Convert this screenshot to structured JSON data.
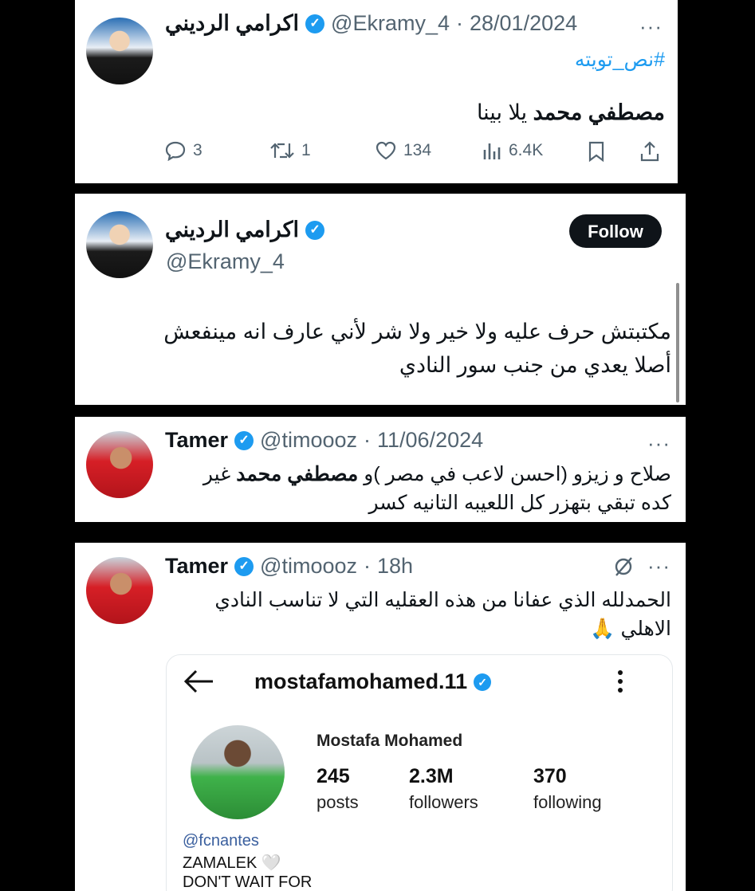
{
  "tweet1": {
    "name": "اكرامي الرديني",
    "handle": "@Ekramy_4",
    "date": "28/01/2024",
    "more_icon": "more-dots-icon",
    "hashtag": "#نص_تويته",
    "body_bold": "مصطفي محمد",
    "body_rest": "يلا بينا",
    "actions": {
      "replies": "3",
      "retweets": "1",
      "likes": "134",
      "views": "6.4K"
    }
  },
  "tweet2": {
    "name": "اكرامي الرديني",
    "handle": "@Ekramy_4",
    "follow_label": "Follow",
    "line1": "مكتبتش حرف عليه ولا خير ولا شر لأني عارف انه مينفعش",
    "line2": "أصلا يعدي من جنب سور النادي"
  },
  "tweet3": {
    "name": "Tamer",
    "handle": "@timoooz",
    "date": "11/06/2024",
    "line1_a": "صلاح و زيزو (احسن لاعب في مصر )و",
    "line1_bold": "مصطفي محمد",
    "line1_b": "غير",
    "line2": "كده تبقي بتهزر كل اللعيبه التانيه كسر"
  },
  "tweet4": {
    "name": "Tamer",
    "handle": "@timoooz",
    "time": "18h",
    "line1": "الحمدلله الذي عفانا من هذه العقليه التي لا تناسب النادي",
    "line2": "الاهلي 🙏",
    "instagram": {
      "username": "mostafamohamed.11",
      "display_name": "Mostafa Mohamed",
      "posts_value": "245",
      "posts_label": "posts",
      "followers_value": "2.3M",
      "followers_label": "followers",
      "following_value": "370",
      "following_label": "following",
      "mention": "@fcnantes",
      "bio1": "ZAMALEK 🤍",
      "bio2": "DON'T WAIT FOR"
    }
  },
  "colors": {
    "link": "#1d9bf0",
    "verified": "#1d9bf0",
    "secondary": "#536471",
    "background": "#000000"
  }
}
